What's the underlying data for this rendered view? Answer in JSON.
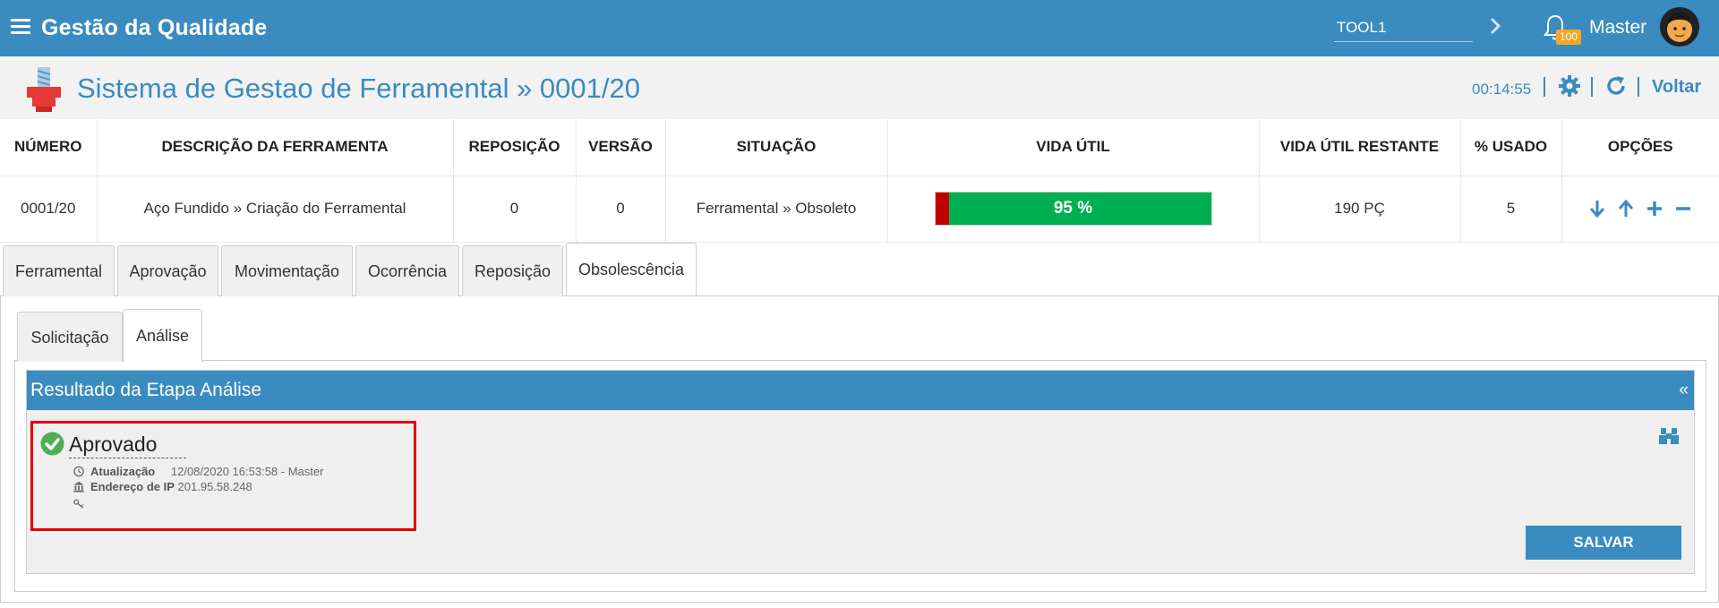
{
  "app": {
    "title": "Gestão da Qualidade"
  },
  "topbar": {
    "tool_value": "TOOL1",
    "notification_count": "100",
    "user_name": "Master"
  },
  "header": {
    "title": "Sistema de Gestao de Ferramental » 0001/20",
    "timer": "00:14:55",
    "back_label": "Voltar"
  },
  "table": {
    "columns": [
      "NÚMERO",
      "DESCRIÇÃO DA FERRAMENTA",
      "REPOSIÇÃO",
      "VERSÃO",
      "SITUAÇÃO",
      "VIDA ÚTIL",
      "VIDA ÚTIL RESTANTE",
      "% USADO",
      "OPÇÕES"
    ],
    "row": {
      "numero": "0001/20",
      "descricao": "Aço Fundido » Criação do Ferramental",
      "reposicao": "0",
      "versao": "0",
      "situacao": "Ferramental » Obsoleto",
      "vida_util_label": "95 %",
      "vida_util_remaining_fraction": 0.95,
      "vida_util_restante": "190 PÇ",
      "usado": "5"
    }
  },
  "tabs": [
    "Ferramental",
    "Aprovação",
    "Movimentação",
    "Ocorrência",
    "Reposição",
    "Obsolescência"
  ],
  "active_tab": "Obsolescência",
  "subtabs": [
    "Solicitação",
    "Análise"
  ],
  "active_subtab": "Análise",
  "result": {
    "title": "Resultado da Etapa Análise",
    "collapse_label": "«",
    "status": "Aprovado",
    "update_label": "Atualização",
    "update_value": "12/08/2020 16:53:58 - Master",
    "ip_label": "Endereço de IP",
    "ip_value": "201.95.58.248",
    "save_label": "SALVAR"
  },
  "colors": {
    "primary": "#3a8bbf",
    "success": "#00b050",
    "danger": "#c00000",
    "highlight": "#e00000",
    "badge": "#f5a623"
  }
}
